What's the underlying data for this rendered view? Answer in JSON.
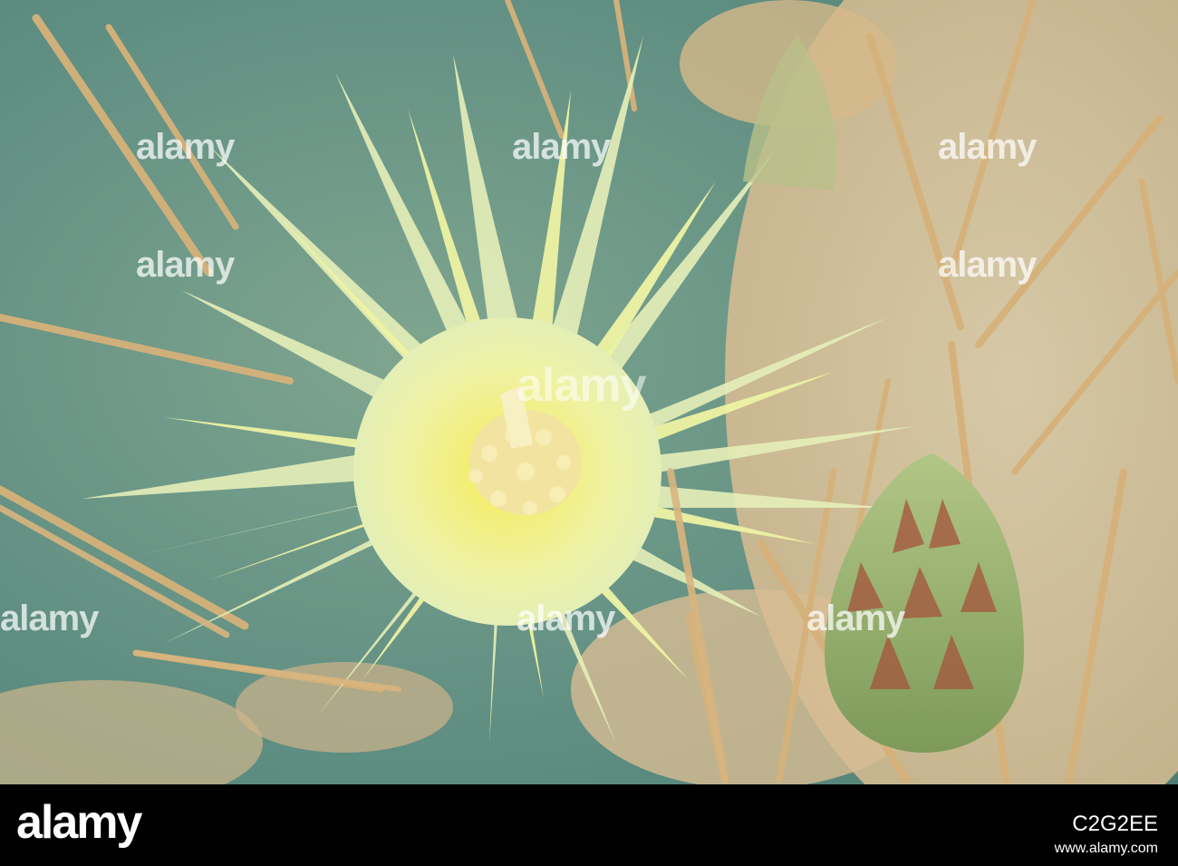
{
  "watermark": {
    "text": "alamy"
  },
  "footer": {
    "logo": "alamy",
    "image_id": "C2G2EE",
    "website": "www.alamy.com"
  },
  "colors": {
    "background_green": "#5f8e82",
    "petal_yellow": "#f1f29a",
    "center_yellow": "#f4e84a",
    "spine_tan": "#d8b77d",
    "bud_green": "#8fa968",
    "bud_red": "#a5533b",
    "footer_black": "#000000"
  }
}
